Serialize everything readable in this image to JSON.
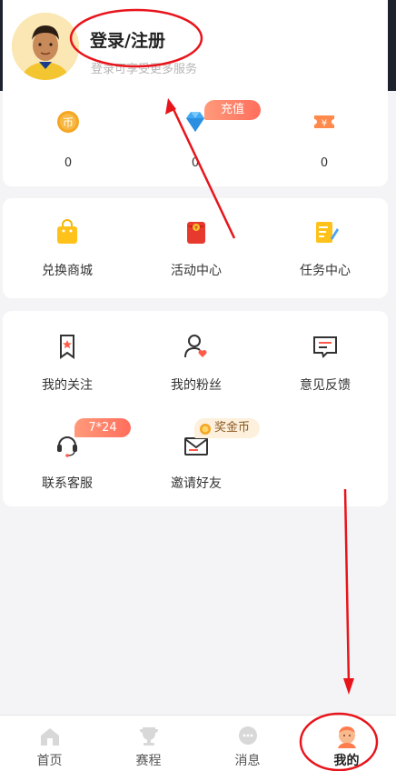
{
  "profile": {
    "login_title": "登录/注册",
    "login_subtitle": "登录可享受更多服务"
  },
  "stats": [
    {
      "icon": "coin-icon",
      "value": "0"
    },
    {
      "icon": "diamond-icon",
      "value": "0",
      "badge": "充值"
    },
    {
      "icon": "ticket-icon",
      "value": "0"
    }
  ],
  "shop": [
    {
      "icon": "shopping-bag-icon",
      "label": "兑换商城"
    },
    {
      "icon": "red-envelope-icon",
      "label": "活动中心"
    },
    {
      "icon": "task-note-icon",
      "label": "任务中心"
    }
  ],
  "menu": [
    {
      "icon": "bookmark-star-icon",
      "label": "我的关注"
    },
    {
      "icon": "user-heart-icon",
      "label": "我的粉丝"
    },
    {
      "icon": "feedback-message-icon",
      "label": "意见反馈"
    },
    {
      "icon": "headset-icon",
      "label": "联系客服",
      "badge": "7*24"
    },
    {
      "icon": "envelope-icon",
      "label": "邀请好友",
      "badge": "奖金币"
    }
  ],
  "tabbar": [
    {
      "icon": "home-icon",
      "label": "首页"
    },
    {
      "icon": "trophy-icon",
      "label": "赛程"
    },
    {
      "icon": "chat-bubble-icon",
      "label": "消息"
    },
    {
      "icon": "profile-avatar-icon",
      "label": "我的",
      "active": true
    }
  ],
  "colors": {
    "accent": "#ff6e5c",
    "annotation": "#e8141b",
    "gold": "#f5a623"
  }
}
